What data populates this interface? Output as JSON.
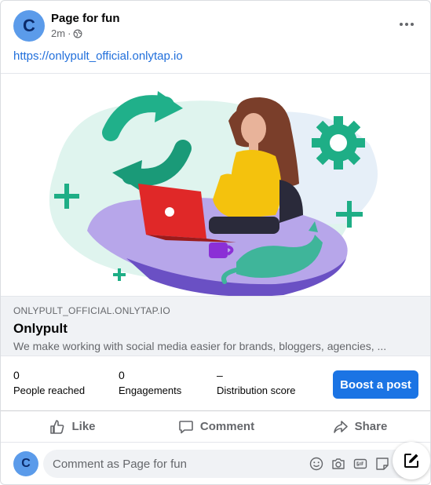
{
  "post": {
    "page_name": "Page for fun",
    "avatar_letter": "C",
    "time": "2m",
    "privacy_icon": "globe-icon",
    "more_icon": "more-horizontal-icon",
    "link_text": "https://onlypult_official.onlytap.io"
  },
  "link_preview": {
    "domain": "ONLYPULT_OFFICIAL.ONLYTAP.IO",
    "title": "Onlypult",
    "description": "We make working with social media easier for brands, bloggers, agencies, ..."
  },
  "stats": {
    "people_reached": {
      "value": "0",
      "label": "People reached"
    },
    "engagements": {
      "value": "0",
      "label": "Engagements"
    },
    "distribution": {
      "value": "–",
      "label": "Distribution score"
    },
    "boost_label": "Boost a post"
  },
  "actions": {
    "like": "Like",
    "comment": "Comment",
    "share": "Share"
  },
  "comment_box": {
    "avatar_letter": "C",
    "placeholder": "Comment as Page for fun",
    "icons": [
      "emoji-icon",
      "camera-icon",
      "gif-icon",
      "sticker-icon"
    ],
    "compose_icon": "compose-icon"
  },
  "colors": {
    "link": "#216fdb",
    "accent": "#1b74e4",
    "muted": "#65676b"
  }
}
